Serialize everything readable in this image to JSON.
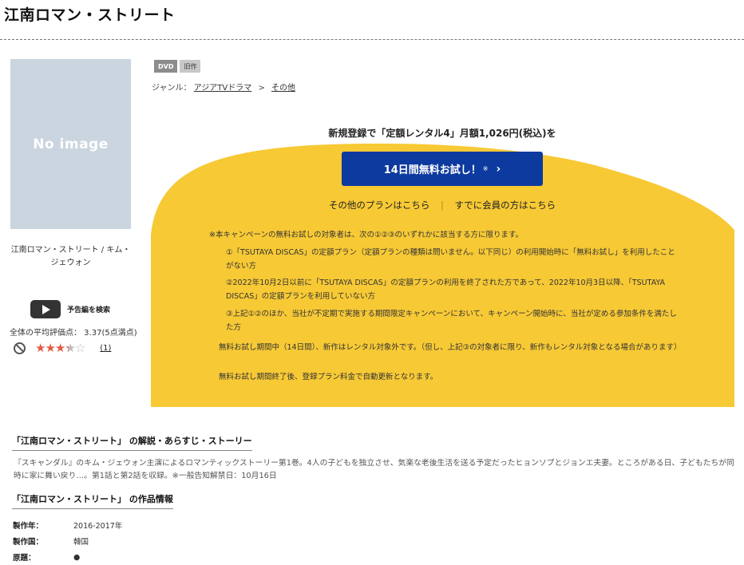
{
  "page": {
    "title": "江南ロマン・ストリート"
  },
  "cover": {
    "placeholder": "No image",
    "caption": "江南ロマン・ストリート / キム・ジェウォン"
  },
  "trailer": {
    "label": "予告編を検索"
  },
  "rating": {
    "average_text": "全体の平均評価点： 3.37(5点満点)",
    "value": 3.37,
    "max": 5,
    "count_text": "(1)"
  },
  "tags": [
    "DVD",
    "旧作"
  ],
  "genre": {
    "label": "ジャンル：",
    "items": [
      "アジアTVドラマ",
      "その他"
    ],
    "separator": ">"
  },
  "campaign": {
    "headline": "新規登録で「定額レンタル4」月額1,026円(税込)を",
    "cta_label": "14日間無料お試し！",
    "cta_mark": "※",
    "cta_arrow": "›",
    "other_plans_link": "その他のプランはこちら",
    "link_separator": "|",
    "member_link": "すでに会員の方はこちら",
    "color": "#f7c935",
    "cta_color": "#0d3a9e",
    "notes": {
      "conditions_intro": "※本キャンペーンの無料お試しの対象者は、次の①②③のいずれかに該当する方に限ります。",
      "item1": "①「TSUTAYA DISCAS」の定額プラン（定額プランの種類は問いません。以下同じ）の利用開始時に「無料お試し」を利用したことがない方",
      "item2": "②2022年10月2日以前に「TSUTAYA DISCAS」の定額プランの利用を終了された方であって、2022年10月3日以降、「TSUTAYA DISCAS」の定額プランを利用していない方",
      "item3": "③上記①②のほか、当社が不定期で実施する期間限定キャンペーンにおいて、キャンペーン開始時に、当社が定める参加条件を満たした方",
      "note1": "無料お試し期間中（14日間）、新作はレンタル対象外です。（但し、上記③の対象者に限り、新作もレンタル対象となる場合があります）",
      "note2": "無料お試し期間終了後、登録プラン料金で自動更新となります。"
    }
  },
  "synopsis": {
    "heading": "「江南ロマン・ストリート」 の解説・あらすじ・ストーリー",
    "text": "『スキャンダル』のキム・ジェウォン主演によるロマンティックストーリー第1巻。4人の子どもを独立させ、気楽な老後生活を送る予定だったヒョンソプとジョンエ夫妻。ところがある日、子どもたちが同時に家に舞い戻り…。第1話と第2話を収録。※一般告知解禁日：10月16日"
  },
  "work_info": {
    "heading": "「江南ロマン・ストリート」 の作品情報",
    "rows": [
      {
        "label": "製作年：",
        "value": "2016-2017年"
      },
      {
        "label": "製作国：",
        "value": "韓国"
      },
      {
        "label": "原題：",
        "value": "●"
      }
    ]
  }
}
